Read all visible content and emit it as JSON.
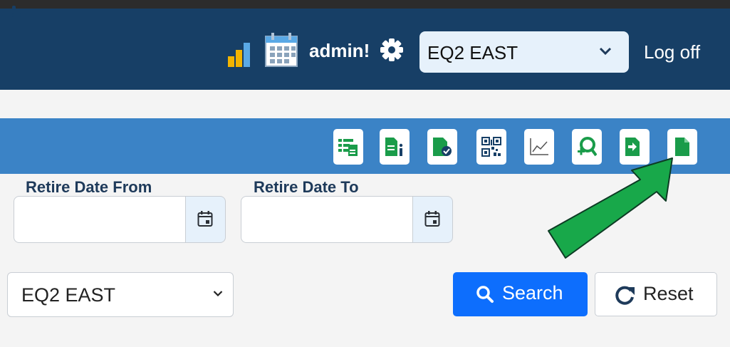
{
  "header": {
    "user_label": "admin!",
    "site_select": {
      "selected": "EQ2 EAST"
    },
    "logoff_label": "Log off",
    "icons": [
      "clock-icon",
      "bar-chart-icon",
      "calendar-icon",
      "gear-icon"
    ]
  },
  "toolbar": {
    "buttons": [
      {
        "name": "list-report-icon"
      },
      {
        "name": "document-info-icon"
      },
      {
        "name": "document-check-icon"
      },
      {
        "name": "qr-code-icon"
      },
      {
        "name": "line-chart-icon"
      },
      {
        "name": "user-search-icon"
      },
      {
        "name": "document-download-icon"
      },
      {
        "name": "document-icon"
      }
    ],
    "accent_color": "#1a9c4a"
  },
  "filters": {
    "retire_from_label": "Retire Date From",
    "retire_from_value": "",
    "retire_to_label": "Retire Date To",
    "retire_to_value": "",
    "area_select": {
      "selected": "EQ2 EAST"
    },
    "search_label": "Search",
    "reset_label": "Reset"
  },
  "colors": {
    "header_bg": "#173f66",
    "toolbar_bg": "#3b83c6",
    "primary_button": "#0d6efd",
    "annotation_arrow": "#18a84a"
  }
}
